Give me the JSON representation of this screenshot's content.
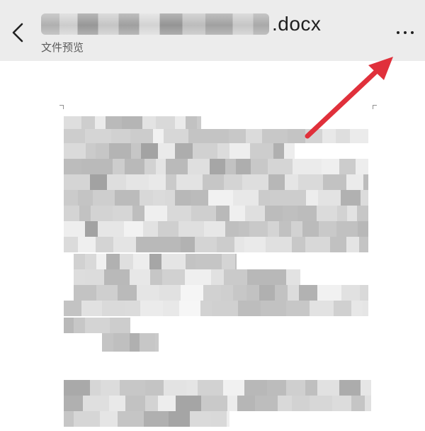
{
  "header": {
    "title_extension": ".docx",
    "subtitle": "文件预览"
  },
  "icons": {
    "back": "chevron-left-icon",
    "more": "more-dots-icon"
  },
  "annotation": {
    "arrow_color": "#e0303b"
  }
}
